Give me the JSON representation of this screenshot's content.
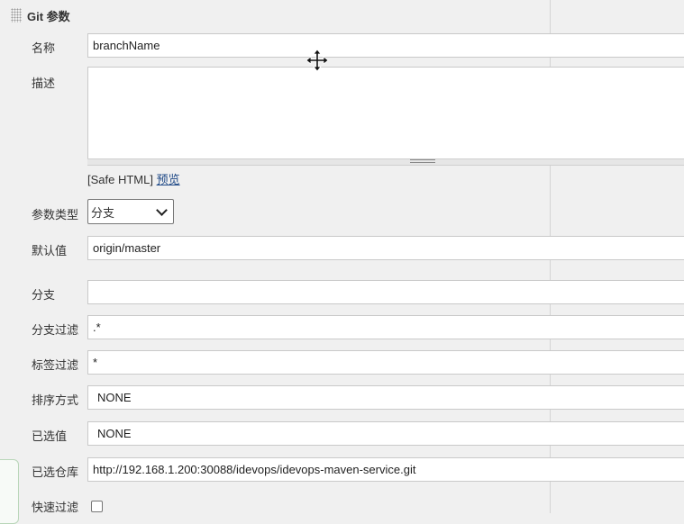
{
  "section": {
    "title": "Git 参数"
  },
  "fields": {
    "name": {
      "label": "名称",
      "value": "branchName"
    },
    "description": {
      "label": "描述",
      "value": ""
    },
    "safe_html": {
      "prefix": "[Safe HTML]",
      "preview_link": "预览"
    },
    "param_type": {
      "label": "参数类型",
      "selected": "分支"
    },
    "default_value": {
      "label": "默认值",
      "value": "origin/master"
    },
    "branch": {
      "label": "分支",
      "value": ""
    },
    "branch_filter": {
      "label": "分支过滤",
      "value": ".*"
    },
    "tag_filter": {
      "label": "标签过滤",
      "value": "*"
    },
    "sort_mode": {
      "label": "排序方式",
      "value": "NONE"
    },
    "selected_value": {
      "label": "已选值",
      "value": "NONE"
    },
    "repository": {
      "label": "已选仓库",
      "value": "http://192.168.1.200:30088/idevops/idevops-maven-service.git"
    },
    "quick_filter": {
      "label": "快速过滤",
      "checked": false
    }
  },
  "icons": {
    "section_grip": "drag-grip-icon",
    "cursor": "move-cursor-icon",
    "select_arrow": "chevron-down-icon"
  },
  "colors": {
    "background": "#f0f0f0",
    "link": "#204a87",
    "field_border": "#c9c9c9"
  }
}
